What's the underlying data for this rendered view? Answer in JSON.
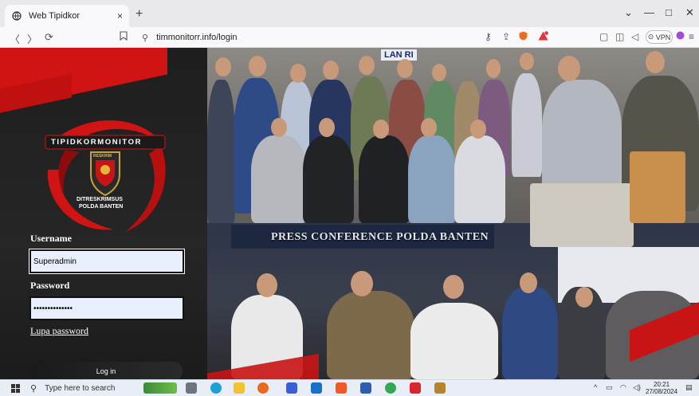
{
  "browser": {
    "tab_title": "Web Tipidkor",
    "tab_close": "×",
    "new_tab": "+",
    "url": "timmonitorr.info/login",
    "vpn_label": "VPN",
    "window_min": "—",
    "window_max": "□",
    "window_close": "✕",
    "tab_search": "⌄"
  },
  "page": {
    "logo_text": "TIPIDKORMONITOR",
    "logo_sub_1": "DITRESKRIMSUS",
    "logo_sub_2": "POLDA BANTEN",
    "logo_badge": "RESKRIM",
    "banner_top": "LAN RI",
    "banner_press": "PRESS CONFERENCE POLDA BANTEN",
    "username_label": "Username",
    "username_value": "Superadmin",
    "password_label": "Password",
    "password_value": "••••••••••••••",
    "forgot_label": "Lupa password",
    "login_label": "Log in"
  },
  "taskbar": {
    "search_placeholder": "Type here to search",
    "time": "20:21",
    "date": "27/08/2024"
  },
  "colors": {
    "accent_red": "#d01414",
    "input_bg": "#e8f0fe",
    "panel_bg": "#1e1e1e"
  }
}
